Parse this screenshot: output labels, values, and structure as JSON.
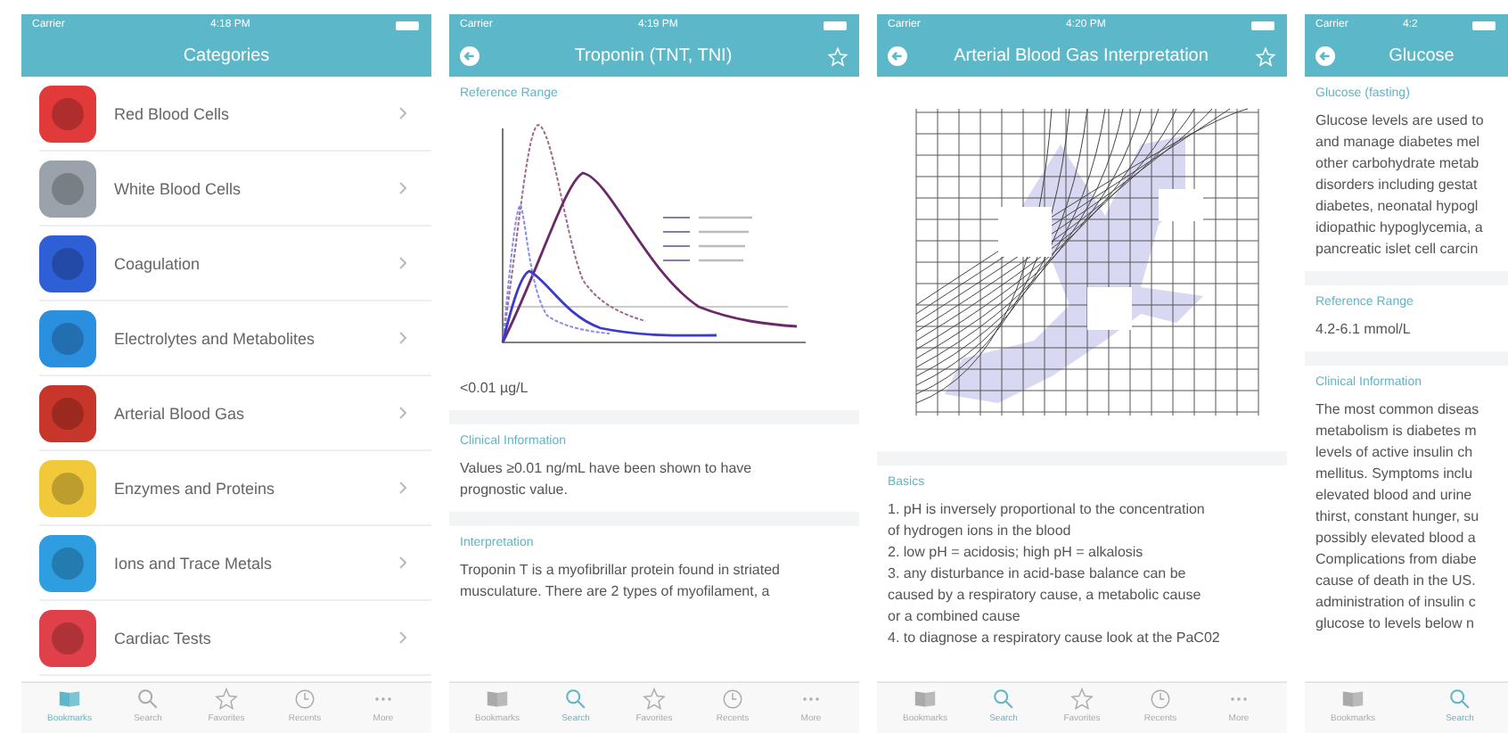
{
  "screens": [
    {
      "kind": "categories",
      "carrier": "Carrier",
      "time": "4:18 PM",
      "title": "Categories",
      "back": false,
      "star": false,
      "items": [
        {
          "label": "Red Blood Cells",
          "color": "#e23a3a"
        },
        {
          "label": "White Blood Cells",
          "color": "#9aa3ab"
        },
        {
          "label": "Coagulation",
          "color": "#2f5fd6"
        },
        {
          "label": "Electrolytes and Metabolites",
          "color": "#2b8fe0"
        },
        {
          "label": "Arterial Blood Gas",
          "color": "#c8352a"
        },
        {
          "label": "Enzymes and Proteins",
          "color": "#f2c93a"
        },
        {
          "label": "Ions and Trace Metals",
          "color": "#2e9ee0"
        },
        {
          "label": "Cardiac Tests",
          "color": "#e0404a"
        }
      ],
      "tabs": [
        {
          "label": "Bookmarks",
          "selected": true
        },
        {
          "label": "Search",
          "selected": false
        },
        {
          "label": "Favorites",
          "selected": false
        },
        {
          "label": "Recents",
          "selected": false
        },
        {
          "label": "More",
          "selected": false
        }
      ]
    },
    {
      "kind": "detail",
      "carrier": "Carrier",
      "time": "4:19 PM",
      "title": "Troponin (TNT, TNI)",
      "back": true,
      "star": true,
      "sections": [
        {
          "heading": "Reference Range",
          "kind": "troponin",
          "lines": [
            "<0.01 µg/L"
          ]
        },
        {
          "heading": "Clinical Information",
          "lines": [
            "Values ≥0.01 ng/mL have been shown to have",
            "prognostic value."
          ]
        },
        {
          "heading": "Interpretation",
          "lines": [
            "Troponin T is a myofibrillar protein found in striated",
            "musculature.   There are 2 types of myofilament, a"
          ]
        }
      ],
      "tabs": [
        {
          "label": "Bookmarks",
          "selected": false
        },
        {
          "label": "Search",
          "selected": true
        },
        {
          "label": "Favorites",
          "selected": false
        },
        {
          "label": "Recents",
          "selected": false
        },
        {
          "label": "More",
          "selected": false
        }
      ]
    },
    {
      "kind": "detail",
      "carrier": "Carrier",
      "time": "4:20 PM",
      "title": "Arterial Blood Gas Interpretation",
      "back": true,
      "star": true,
      "sections": [
        {
          "kind": "blood_gas"
        },
        {
          "heading": "Basics",
          "lines": [
            "1. pH is inversely proportional to the concentration",
            "of hydrogen ions in the blood",
            "2. low pH = acidosis; high pH = alkalosis",
            "3. any disturbance in acid-base balance can be",
            "caused by a respiratory cause, a  metabolic cause",
            "or a combined cause",
            "4. to diagnose a respiratory cause look at the PaC02"
          ]
        }
      ],
      "tabs": [
        {
          "label": "Bookmarks",
          "selected": false
        },
        {
          "label": "Search",
          "selected": true
        },
        {
          "label": "Favorites",
          "selected": false
        },
        {
          "label": "Recents",
          "selected": false
        },
        {
          "label": "More",
          "selected": false
        }
      ]
    },
    {
      "kind": "detail",
      "carrier": "Carrier",
      "time": "4:2",
      "title": "Glucose",
      "back": true,
      "star": false,
      "sections": [
        {
          "heading": "Glucose (fasting)",
          "lines": [
            "Glucose levels are used to",
            "and manage diabetes mel",
            "other carbohydrate metab",
            "disorders including gestat",
            "diabetes, neonatal hypogl",
            "idiopathic hypoglycemia, a",
            "pancreatic islet cell carcin"
          ]
        },
        {
          "heading": "Reference Range",
          "lines": [
            "4.2-6.1 mmol/L"
          ]
        },
        {
          "heading": "Clinical Information",
          "lines": [
            "The most common diseas",
            "metabolism is  diabetes m",
            "levels of active insulin  ch",
            "mellitus. Symptoms inclu",
            "elevated blood and urine",
            "thirst, constant hunger, su",
            "possibly elevated  blood a",
            "Complications from diabe",
            "cause of death in the US.",
            "administration of insulin c",
            "glucose to levels below n"
          ]
        }
      ],
      "tabs": [
        {
          "label": "Bookmarks",
          "selected": false
        },
        {
          "label": "Search",
          "selected": true
        }
      ]
    }
  ]
}
